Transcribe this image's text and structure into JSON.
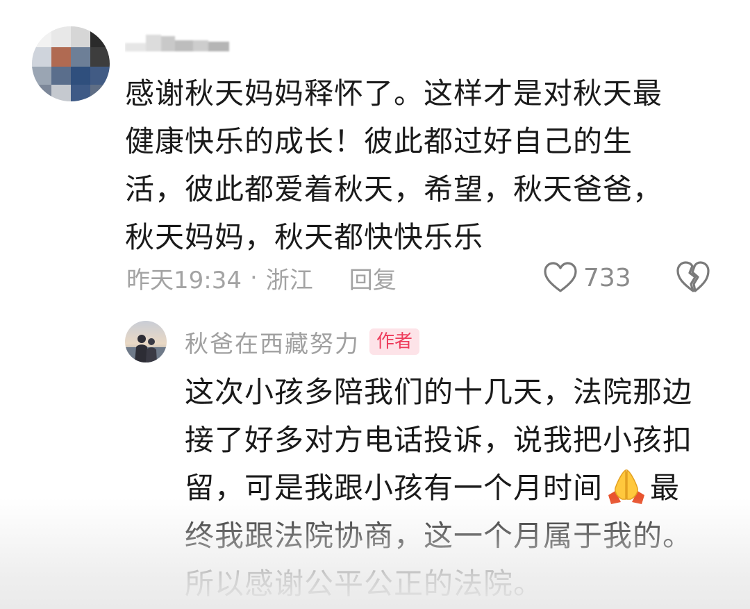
{
  "top_comment": {
    "username": "",
    "text_lines": [
      "感谢秋天妈妈释怀了。这样才是对秋天最",
      "健康快乐的成长！彼此都过好自己的生",
      "活，彼此都爱着秋天，希望，秋天爸爸，",
      "秋天妈妈，秋天都快快乐乐"
    ],
    "time": "昨天19:34",
    "separator": "·",
    "location": "浙江",
    "reply_label": "回复",
    "like_count": "733",
    "icons": {
      "like": "heart-outline-icon",
      "dislike": "broken-heart-icon"
    }
  },
  "reply": {
    "username": "秋爸在西藏努力",
    "badge": "作者",
    "text_line1": "这次小孩多陪我们的十几天，法院那边",
    "text_line2": "接了好多对方电话投诉，说我把小孩扣",
    "text_line3_before_emoji": "留，可是我跟小孩有一个月时间",
    "emoji": "folded-hands-emoji",
    "text_line3_after_emoji": "最",
    "text_line4": "终我跟法院协商，这一个月属于我的。",
    "text_line5": "所以感谢公平公正的法院。"
  },
  "colors": {
    "text_primary": "#1a1a1a",
    "text_meta": "#a3a3a3",
    "badge_bg": "#fde3e8",
    "badge_text": "#ee3b5b",
    "icon_stroke": "#7a7a7a"
  }
}
